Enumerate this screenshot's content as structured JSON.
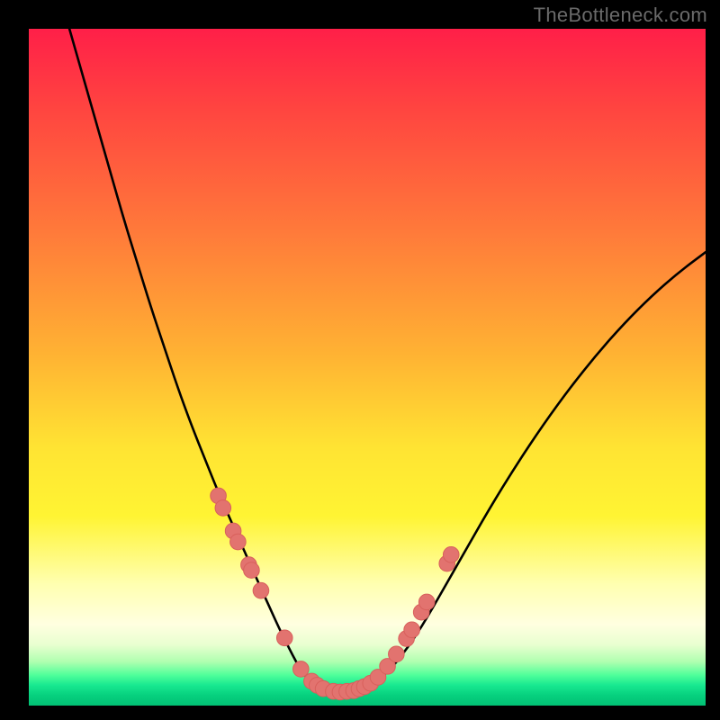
{
  "watermark": "TheBottleneck.com",
  "colors": {
    "background_frame": "#000000",
    "gradient_top": "#ff1f48",
    "gradient_bottom": "#02c074",
    "curve_stroke": "#000000",
    "marker_fill": "#e2736f",
    "marker_stroke": "#d8605c"
  },
  "chart_data": {
    "type": "line",
    "title": "",
    "xlabel": "",
    "ylabel": "",
    "xlim": [
      0,
      100
    ],
    "ylim": [
      0,
      100
    ],
    "grid": false,
    "legend": false,
    "series": [
      {
        "name": "bottleneck-curve",
        "x": [
          6,
          8,
          10,
          12,
          14,
          16,
          18,
          20,
          22,
          24,
          26,
          28,
          30,
          32,
          34,
          35,
          36,
          37,
          38,
          39,
          40,
          41,
          42,
          43,
          44,
          46,
          48,
          50,
          52,
          54,
          56,
          58,
          60,
          64,
          68,
          72,
          76,
          80,
          84,
          88,
          92,
          96,
          100
        ],
        "y": [
          100,
          93,
          86,
          79,
          72,
          65.5,
          59,
          53,
          47,
          41.5,
          36.5,
          31.5,
          27,
          22.5,
          18,
          15.8,
          13.6,
          11.4,
          9.4,
          7.4,
          5.6,
          4.2,
          3.2,
          2.6,
          2.2,
          2.0,
          2.2,
          2.8,
          4.0,
          6.0,
          8.6,
          11.6,
          15.0,
          22.0,
          29.0,
          35.5,
          41.5,
          47.0,
          52.0,
          56.5,
          60.5,
          64.0,
          67.0
        ]
      }
    ],
    "markers": [
      {
        "x": 28.0,
        "y": 31.0
      },
      {
        "x": 28.7,
        "y": 29.2
      },
      {
        "x": 30.2,
        "y": 25.8
      },
      {
        "x": 30.9,
        "y": 24.2
      },
      {
        "x": 32.5,
        "y": 20.8
      },
      {
        "x": 32.9,
        "y": 20.0
      },
      {
        "x": 34.3,
        "y": 17.0
      },
      {
        "x": 37.8,
        "y": 10.0
      },
      {
        "x": 40.2,
        "y": 5.4
      },
      {
        "x": 41.8,
        "y": 3.6
      },
      {
        "x": 42.6,
        "y": 3.0
      },
      {
        "x": 43.5,
        "y": 2.5
      },
      {
        "x": 45.0,
        "y": 2.1
      },
      {
        "x": 46.0,
        "y": 2.0
      },
      {
        "x": 47.0,
        "y": 2.1
      },
      {
        "x": 48.0,
        "y": 2.2
      },
      {
        "x": 48.8,
        "y": 2.5
      },
      {
        "x": 49.6,
        "y": 2.8
      },
      {
        "x": 50.5,
        "y": 3.3
      },
      {
        "x": 51.6,
        "y": 4.2
      },
      {
        "x": 53.0,
        "y": 5.8
      },
      {
        "x": 54.3,
        "y": 7.6
      },
      {
        "x": 55.8,
        "y": 9.9
      },
      {
        "x": 56.6,
        "y": 11.2
      },
      {
        "x": 58.0,
        "y": 13.8
      },
      {
        "x": 58.8,
        "y": 15.3
      },
      {
        "x": 61.8,
        "y": 21.0
      },
      {
        "x": 62.4,
        "y": 22.3
      }
    ]
  }
}
